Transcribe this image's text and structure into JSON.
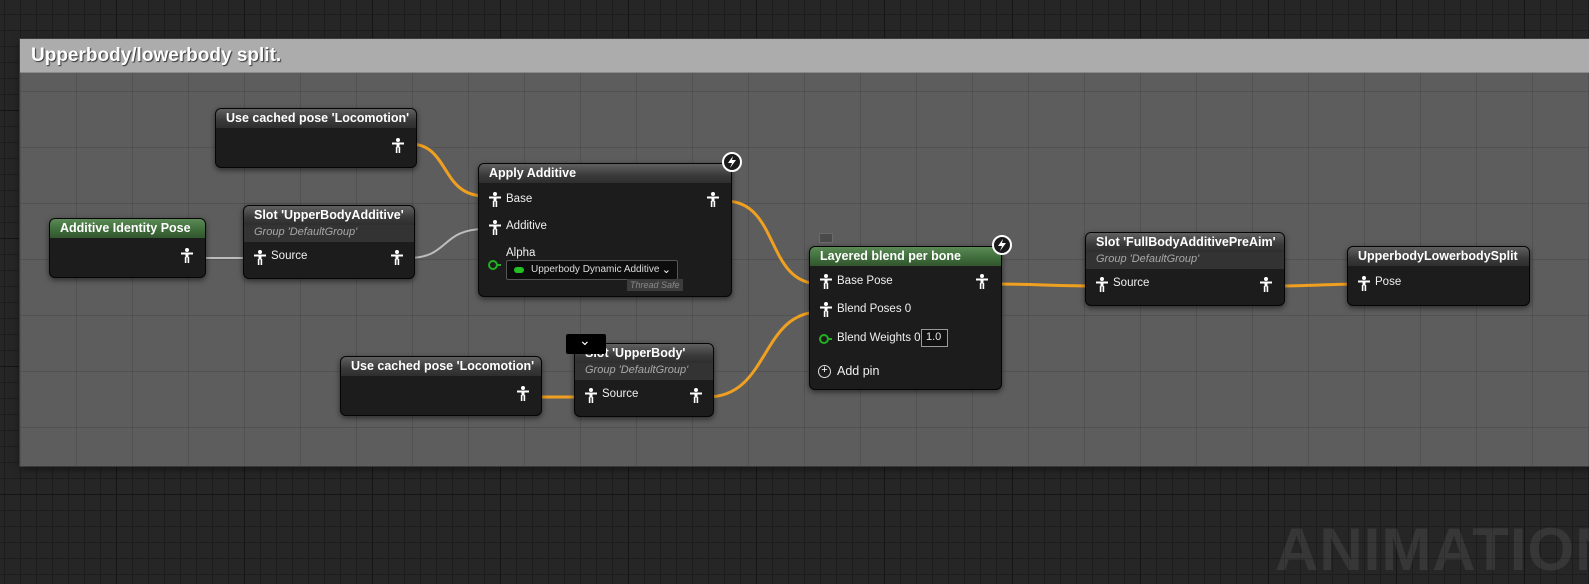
{
  "comment": {
    "title": "Upperbody/lowerbody split."
  },
  "nodes": {
    "cached_pose_1": {
      "title": "Use cached pose 'Locomotion'"
    },
    "identity_pose": {
      "title": "Additive Identity Pose"
    },
    "slot_upperbody_additive": {
      "title": "Slot 'UpperBodyAdditive'",
      "group": "Group 'DefaultGroup'",
      "pin_source": "Source"
    },
    "apply_additive": {
      "title": "Apply Additive",
      "pin_base": "Base",
      "pin_additive": "Additive",
      "pin_alpha": "Alpha",
      "alpha_value": "Upperbody Dynamic Additive W",
      "thread_safe": "Thread Safe"
    },
    "cached_pose_2": {
      "title": "Use cached pose 'Locomotion'"
    },
    "slot_upperbody": {
      "title": "Slot 'UpperBody'",
      "group": "Group 'DefaultGroup'",
      "pin_source": "Source"
    },
    "layered_blend": {
      "title": "Layered blend per bone",
      "pin_base_pose": "Base Pose",
      "pin_blend_poses": "Blend Poses 0",
      "pin_blend_weights": "Blend Weights 0",
      "blend_weight_value": "1.0",
      "add_pin": "Add pin"
    },
    "slot_fullbody": {
      "title": "Slot 'FullBodyAdditivePreAim'",
      "group": "Group 'DefaultGroup'",
      "pin_source": "Source"
    },
    "output_pose": {
      "title": "UpperbodyLowerbodySplit",
      "pin_pose": "Pose"
    }
  },
  "watermark": "ANIMATION",
  "colors": {
    "pose_wire": "#f0a020",
    "plain_wire": "#bdbdbd",
    "exec_green": "#22b022",
    "node_header_green": "#3e6b3a"
  },
  "icons": {
    "pose_pin": "pose-person-icon",
    "fast_path": "lightning-bolt-icon",
    "add": "add-circle-icon"
  }
}
